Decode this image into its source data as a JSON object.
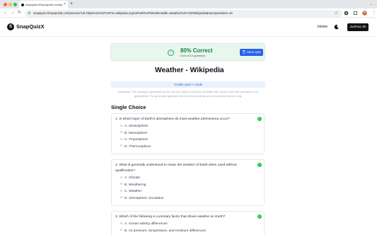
{
  "browser": {
    "tab_title": "snapquizx.fivepopclub.com/pr...",
    "close_glyph": "×",
    "new_tab_glyph": "+",
    "tab_chevron_glyph": "⌄",
    "back_glyph": "←",
    "forward_glyph": "→",
    "reload_glyph": "↻",
    "url": "snapquizx.fivepopclub.com/practice?url=https%3A%2F%2Fen.wikipedia.org%2Fwiki%2FWeather&title=Weather%20-%20Wikipedia&numQuestions=10",
    "star_glyph": "☆",
    "traffic_colors": [
      "#ff5f57",
      "#febc2e",
      "#28c840"
    ]
  },
  "header": {
    "logo_mark": "S",
    "logo_text": "SnapQuizX",
    "home_label": "Home",
    "user_label": "Junhua Jin"
  },
  "score": {
    "check_glyph": "✓",
    "percent_text": "80% Correct",
    "subtext": "8 out of 10 questions",
    "save_icon_glyph": "⎘",
    "save_label": "Save Quiz",
    "accent": "#15803d"
  },
  "page": {
    "title": "Weather - Wikipedia",
    "credits": "Credits used: 1 credit",
    "disclaimer": "Disclaimer: The questions generated by this tool are based on publicly available wiki content, and their accuracy is not guaranteed. The generated questions are for personal study and non-commercial use only.",
    "section_title": "Single Choice"
  },
  "questions": [
    {
      "text": "1.  In which layer of Earth's atmosphere do most weather phenomena occur?",
      "status_glyph": "✓",
      "options": [
        "A. Stratosphere",
        "B. Mesosphere",
        "C. Troposphere",
        "D. Thermosphere"
      ]
    },
    {
      "text_line1": "2.  What is generally understood to mean the weather of Earth when used without",
      "text_line2": "qualification?",
      "status_glyph": "✓",
      "options": [
        "A. Climate",
        "B. Weathering",
        "C. Weather",
        "D. Atmospheric circulation"
      ]
    },
    {
      "text": "3.  Which of the following is a primary factor that drives weather on Earth?",
      "status_glyph": "✓",
      "options": [
        "A. Ocean salinity differences",
        "B. Air pressure, temperature, and moisture differences"
      ]
    }
  ]
}
